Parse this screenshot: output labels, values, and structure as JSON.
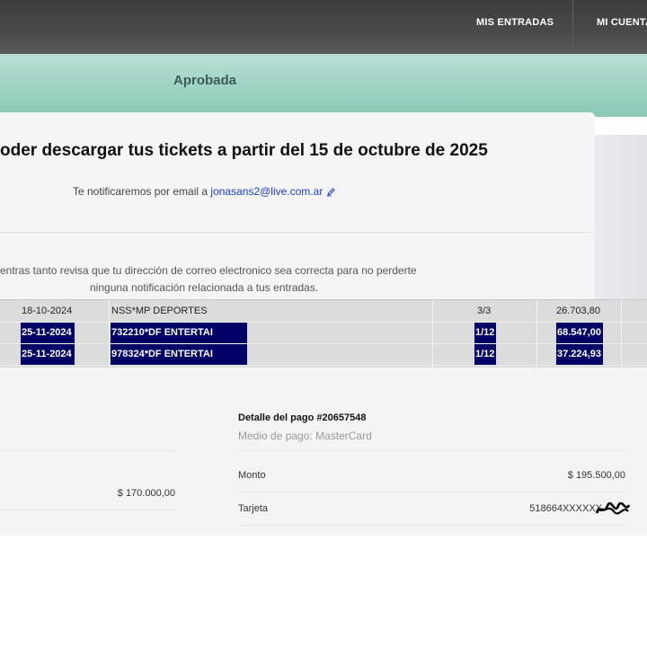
{
  "nav": {
    "items": [
      "MIS ENTRADAS",
      "MI CUENTA"
    ]
  },
  "status": "Aprobada",
  "headline": "oder descargar tus tickets a partir del 15 de octubre de 2025",
  "notify": {
    "text": "Te notificaremos por email a ",
    "email": "jonasans2@live.com.ar",
    "icon": "edit-icon"
  },
  "note": {
    "line1": "entras tanto revisa que tu dirección de correo electronico sea correcta para no perderte",
    "line2": "ninguna notificación relacionada a tus entradas."
  },
  "transactions": [
    {
      "date": "18-10-2024",
      "description": "NSS*MP DEPORTES",
      "installments": "3/3",
      "amount": "26.703,80",
      "highlighted": false
    },
    {
      "date": "25-11-2024",
      "description": "732210*DF ENTERTAI",
      "installments": "1/12",
      "amount": "68.547,00",
      "highlighted": true
    },
    {
      "date": "25-11-2024",
      "description": "978324*DF ENTERTAI",
      "installments": "1/12",
      "amount": "37.224,93",
      "highlighted": true
    }
  ],
  "left_amount": "$ 170.000,00",
  "payment": {
    "title": "Detalle del pago #20657548",
    "method": "Medio de pago: MasterCard",
    "rows": [
      {
        "label": "Monto",
        "value": "$ 195.500,00"
      },
      {
        "label": "Tarjeta",
        "value": "518664XXXXXX"
      }
    ]
  },
  "colors": {
    "nav_bg": "#404040",
    "teal": "#9fd3c3",
    "highlight": "#000066",
    "email": "#1a3ed1"
  }
}
